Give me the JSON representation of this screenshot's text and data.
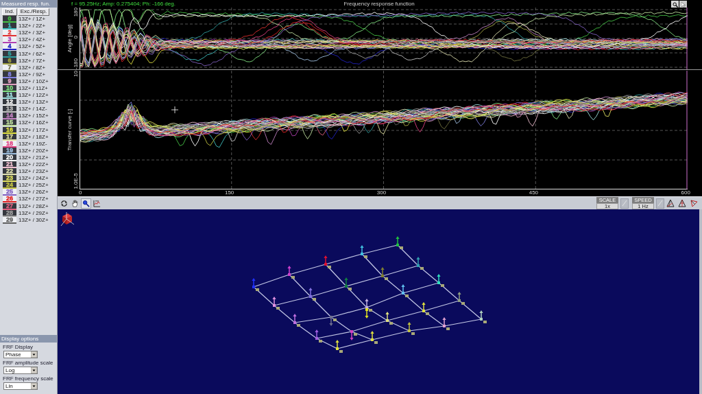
{
  "measured_responses": {
    "title": "Measured resp. fun.",
    "columns": [
      "Ind.",
      "Exc./Resp."
    ],
    "rows": [
      {
        "index": "0",
        "color": "#44c044",
        "pair": "13Z+ / 1Z+"
      },
      {
        "index": "1",
        "color": "#40c0c0",
        "pair": "13Z+ / 2Z+"
      },
      {
        "index": "2",
        "color": "#e03030",
        "pair": "13Z+ / 3Z+"
      },
      {
        "index": "3",
        "color": "#b040b0",
        "pair": "13Z+ / 4Z+"
      },
      {
        "index": "4",
        "color": "#2020c0",
        "pair": "13Z+ / 5Z+"
      },
      {
        "index": "5",
        "color": "#30a0a0",
        "pair": "13Z+ / 6Z+"
      },
      {
        "index": "6",
        "color": "#a0a040",
        "pair": "13Z+ / 7Z+"
      },
      {
        "index": "7",
        "color": "#707040",
        "pair": "13Z+ / 8Z+"
      },
      {
        "index": "8",
        "color": "#8080e0",
        "pair": "13Z+ / 9Z+"
      },
      {
        "index": "9",
        "color": "#e0a0c0",
        "pair": "13Z+ / 10Z+"
      },
      {
        "index": "10",
        "color": "#80e080",
        "pair": "13Z+ / 11Z+"
      },
      {
        "index": "11",
        "color": "#a0e0e0",
        "pair": "13Z+ / 12Z+"
      },
      {
        "index": "12",
        "color": "#ffffff",
        "pair": "13Z+ / 13Z+"
      },
      {
        "index": "13",
        "color": "#c0c0c0",
        "pair": "13Z+ / 14Z-"
      },
      {
        "index": "14",
        "color": "#c080c0",
        "pair": "13Z+ / 15Z+"
      },
      {
        "index": "15",
        "color": "#c0e0a0",
        "pair": "13Z+ / 16Z+"
      },
      {
        "index": "16",
        "color": "#e0e040",
        "pair": "13Z+ / 17Z+"
      },
      {
        "index": "17",
        "color": "#e0e0a0",
        "pair": "13Z+ / 18Z+"
      },
      {
        "index": "18",
        "color": "#e04080",
        "pair": "13Z+ / 19Z-"
      },
      {
        "index": "19",
        "color": "#a0c0e0",
        "pair": "13Z+ / 20Z+"
      },
      {
        "index": "20",
        "color": "#ffffff",
        "pair": "13Z+ / 21Z+"
      },
      {
        "index": "21",
        "color": "#f0c0d0",
        "pair": "13Z+ / 22Z+"
      },
      {
        "index": "22",
        "color": "#e0e0b0",
        "pair": "13Z+ / 23Z+"
      },
      {
        "index": "23",
        "color": "#e0e060",
        "pair": "13Z+ / 24Z+"
      },
      {
        "index": "24",
        "color": "#c0c040",
        "pair": "13Z+ / 25Z+"
      },
      {
        "index": "25",
        "color": "#8060c0",
        "pair": "13Z+ / 26Z+"
      },
      {
        "index": "26",
        "color": "#e02020",
        "pair": "13Z+ / 27Z+"
      },
      {
        "index": "27",
        "color": "#e06080",
        "pair": "13Z+ / 28Z+"
      },
      {
        "index": "28",
        "color": "#a0a0a0",
        "pair": "13Z+ / 29Z+"
      },
      {
        "index": "29",
        "color": "#606060",
        "pair": "13Z+ / 30Z+"
      }
    ]
  },
  "display_options": {
    "title": "Display options",
    "fields": [
      {
        "label": "FRF Display",
        "value": "Phase"
      },
      {
        "label": "FRF amplitude scale",
        "value": "Log"
      },
      {
        "label": "FRF frequency scale",
        "value": "Lin"
      }
    ]
  },
  "frf_chart": {
    "readout": "f = 95.25Hz; Amp: 0.275404; Ph: -166 deg.",
    "title": "Frequency response function",
    "phase_plot": {
      "ylabel": "Angle [deg]",
      "ytick_labels": [
        "180",
        "0",
        "-180"
      ]
    },
    "amplitude_plot": {
      "ylabel": "Transfer curve [-]",
      "ytick_labels": [
        "10",
        "1.0E-5"
      ]
    },
    "xtick_labels": [
      "0",
      "150",
      "300",
      "450",
      "600"
    ]
  },
  "toolbar": {
    "scale": {
      "label": "SCALE",
      "value": "1x"
    },
    "speed": {
      "label": "SPEED",
      "value": "1 Hz"
    }
  }
}
